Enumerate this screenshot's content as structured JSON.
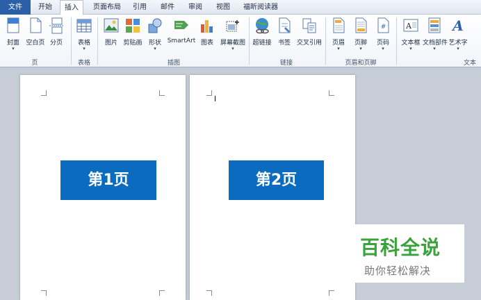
{
  "tabs": {
    "file": "文件",
    "home": "开始",
    "insert": "插入",
    "page_layout": "页面布局",
    "references": "引用",
    "mailings": "邮件",
    "review": "审阅",
    "view": "视图",
    "foxit": "福昕阅读器"
  },
  "ribbon": {
    "page_group": {
      "label": "页",
      "cover": "封面",
      "blank": "空白页",
      "break": "分页"
    },
    "table_group": {
      "label": "表格",
      "table": "表格"
    },
    "illustration_group": {
      "label": "插图",
      "picture": "图片",
      "clipart": "剪贴画",
      "shapes": "形状",
      "smartart": "SmartArt",
      "chart": "图表",
      "screenshot": "屏幕截图"
    },
    "link_group": {
      "label": "链接",
      "hyperlink": "超链接",
      "bookmark": "书签",
      "crossref": "交叉引用"
    },
    "header_group": {
      "label": "页眉和页脚",
      "header": "页眉",
      "footer": "页脚",
      "pagenum": "页码"
    },
    "text_group": {
      "label": "文本",
      "textbox": "文本框",
      "quickparts": "文档部件",
      "wordart": "艺术字"
    },
    "dropdown_glyph": "▾"
  },
  "document": {
    "page1_title": "第1页",
    "page2_title": "第2页"
  },
  "watermark": {
    "main": "百科全说",
    "sub": "助你轻松解决"
  },
  "colors": {
    "accent": "#0b6cbf",
    "file_tab": "#2b5fa8",
    "watermark_green": "#3aa23a"
  }
}
